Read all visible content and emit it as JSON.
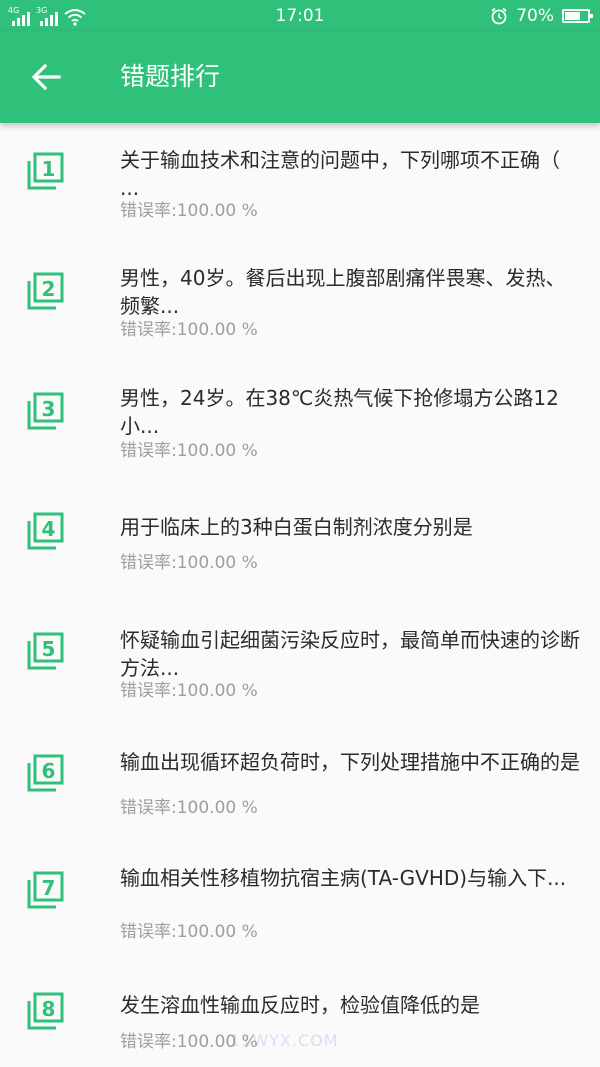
{
  "status_bar": {
    "network_1": "4G",
    "network_2": "3G",
    "time": "17:01",
    "battery": "70%",
    "battery_level": 0.7,
    "icons": [
      "signal-icon",
      "wifi-icon",
      "alarm-icon",
      "battery-icon"
    ]
  },
  "header": {
    "title": "错题排行",
    "back_icon": "arrow-left-icon",
    "color": "#2fc07a"
  },
  "error_rate_label": "错误率:",
  "items": [
    {
      "rank": "1",
      "question": "关于输血技术和注意的问题中，下列哪项不正确（   ...",
      "error_rate": "100.00 %"
    },
    {
      "rank": "2",
      "question": "男性，40岁。餐后出现上腹部剧痛伴畏寒、发热、频繁...",
      "error_rate": "100.00 %"
    },
    {
      "rank": "3",
      "question": "男性，24岁。在38℃炎热气候下抢修塌方公路12小...",
      "error_rate": "100.00 %"
    },
    {
      "rank": "4",
      "question": "用于临床上的3种白蛋白制剂浓度分别是",
      "error_rate": "100.00 %"
    },
    {
      "rank": "5",
      "question": "怀疑输血引起细菌污染反应时，最简单而快速的诊断方法...",
      "error_rate": "100.00 %"
    },
    {
      "rank": "6",
      "question": "输血出现循环超负荷时，下列处理措施中不正确的是",
      "error_rate": "100.00 %"
    },
    {
      "rank": "7",
      "question": "输血相关性移植物抗宿主病(TA-GVHD)与输入下...",
      "error_rate": "100.00 %"
    },
    {
      "rank": "8",
      "question": "发生溶血性输血反应时，检验值降低的是",
      "error_rate": "100.00 %"
    }
  ],
  "watermark": "11WYX.COM"
}
